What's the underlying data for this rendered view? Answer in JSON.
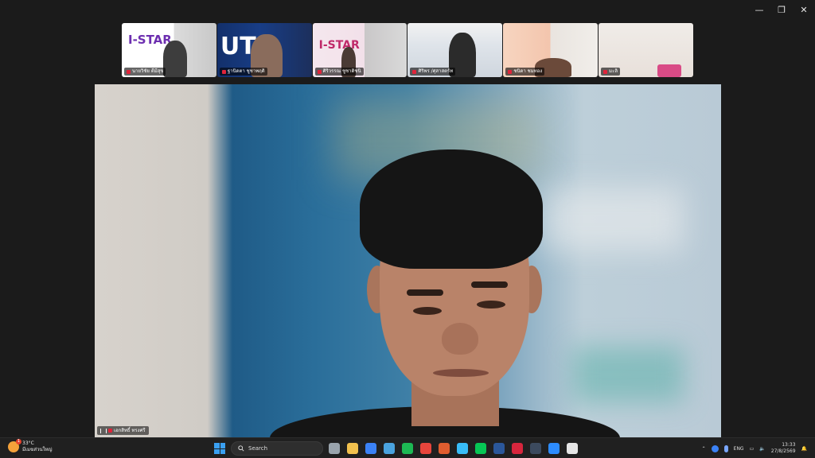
{
  "window": {
    "controls": {
      "minimize": "—",
      "restore": "❐",
      "close": "✕"
    }
  },
  "participants": [
    {
      "name": "นายวิชัย ดีมีสุข",
      "banner": "I-STAR"
    },
    {
      "name": "ฐานิดตา ชูชาพฤติ",
      "banner": "UTS"
    },
    {
      "name": "ศิริวรรณ ชูชาติชนิ",
      "banner": "I-STAR"
    },
    {
      "name": "ศิริพร /ศุสาสตร์ท"
    },
    {
      "name": "ชนิดา ชมทอง"
    },
    {
      "name": "มะลิ"
    }
  ],
  "main_speaker": {
    "name": "เอกสิทธิ์ ทรงศรี"
  },
  "taskbar": {
    "weather": {
      "temp": "33°C",
      "desc": "มีเมฆส่วนใหญ่",
      "badge": "1"
    },
    "search_label": "Search",
    "language": "ENG",
    "time": "13:33",
    "date": "27/8/2569",
    "apps": [
      {
        "name": "camera-icon",
        "color": "#9aa4ad"
      },
      {
        "name": "file-explorer-icon",
        "color": "#f2c14e"
      },
      {
        "name": "store-icon",
        "color": "#3b82f6"
      },
      {
        "name": "mail-icon",
        "color": "#4aa3df"
      },
      {
        "name": "spotify-icon",
        "color": "#1db954"
      },
      {
        "name": "chrome-icon",
        "color": "#e8453c"
      },
      {
        "name": "office-icon",
        "color": "#e05d2f"
      },
      {
        "name": "notepad-icon",
        "color": "#38bdf8"
      },
      {
        "name": "line-icon",
        "color": "#06c755"
      },
      {
        "name": "word-icon",
        "color": "#2b579a"
      },
      {
        "name": "pdf-icon",
        "color": "#d7263d"
      },
      {
        "name": "lc-icon",
        "color": "#3c4a5e"
      },
      {
        "name": "zoom-icon",
        "color": "#2d8cff"
      },
      {
        "name": "media-player-icon",
        "color": "#e6e6e6"
      }
    ]
  }
}
